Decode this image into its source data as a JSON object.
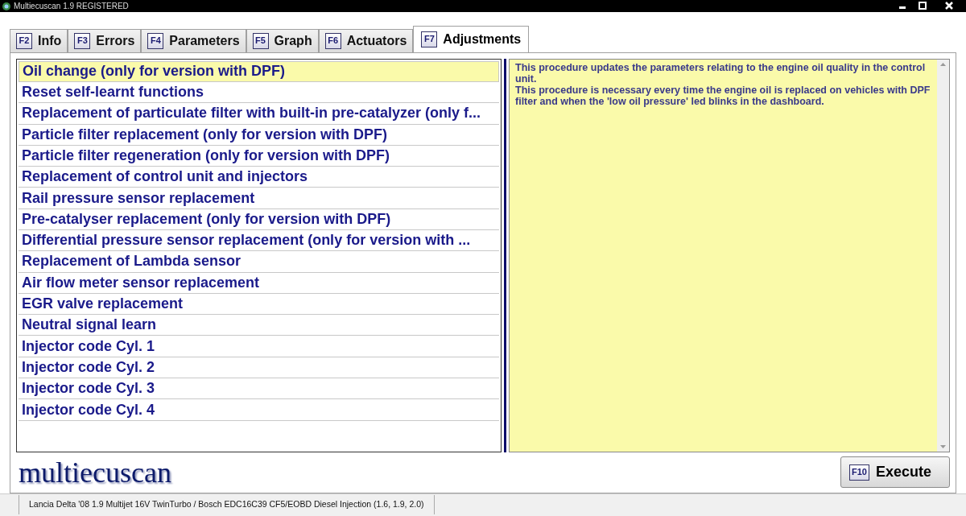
{
  "window": {
    "title": "Multiecuscan 1.9 REGISTERED"
  },
  "tabs": [
    {
      "key": "F2",
      "label": "Info",
      "selected": false
    },
    {
      "key": "F3",
      "label": "Errors",
      "selected": false
    },
    {
      "key": "F4",
      "label": "Parameters",
      "selected": false
    },
    {
      "key": "F5",
      "label": "Graph",
      "selected": false
    },
    {
      "key": "F6",
      "label": "Actuators",
      "selected": false
    },
    {
      "key": "F7",
      "label": "Adjustments",
      "selected": true
    }
  ],
  "procedures": [
    {
      "label": "Oil change (only for version with DPF)",
      "selected": true
    },
    {
      "label": "Reset self-learnt functions",
      "selected": false
    },
    {
      "label": "Replacement of particulate filter with built-in pre-catalyzer (only f...",
      "selected": false
    },
    {
      "label": "Particle filter replacement (only for version with DPF)",
      "selected": false
    },
    {
      "label": "Particle filter regeneration (only for version with DPF)",
      "selected": false
    },
    {
      "label": "Replacement of control unit and injectors",
      "selected": false
    },
    {
      "label": "Rail pressure sensor replacement",
      "selected": false
    },
    {
      "label": "Pre-catalyser replacement (only for version with DPF)",
      "selected": false
    },
    {
      "label": "Differential pressure sensor replacement (only for version with ...",
      "selected": false
    },
    {
      "label": "Replacement of Lambda sensor",
      "selected": false
    },
    {
      "label": "Air flow meter sensor replacement",
      "selected": false
    },
    {
      "label": "EGR valve replacement",
      "selected": false
    },
    {
      "label": "Neutral signal learn",
      "selected": false
    },
    {
      "label": "Injector code Cyl. 1",
      "selected": false
    },
    {
      "label": "Injector code Cyl. 2",
      "selected": false
    },
    {
      "label": "Injector code Cyl. 3",
      "selected": false
    },
    {
      "label": "Injector code Cyl. 4",
      "selected": false
    }
  ],
  "description": [
    "This procedure updates the parameters relating to the engine oil quality in the control unit.",
    "This procedure is necessary every time the engine oil is replaced on vehicles with DPF filter and when the 'low oil pressure' led blinks in the dashboard."
  ],
  "logo": "multiecuscan",
  "execute_button": {
    "key": "F10",
    "label": "Execute"
  },
  "status_bar": "Lancia Delta '08 1.9 Multijet 16V TwinTurbo / Bosch EDC16C39 CF5/EOBD Diesel Injection (1.6, 1.9, 2.0)"
}
